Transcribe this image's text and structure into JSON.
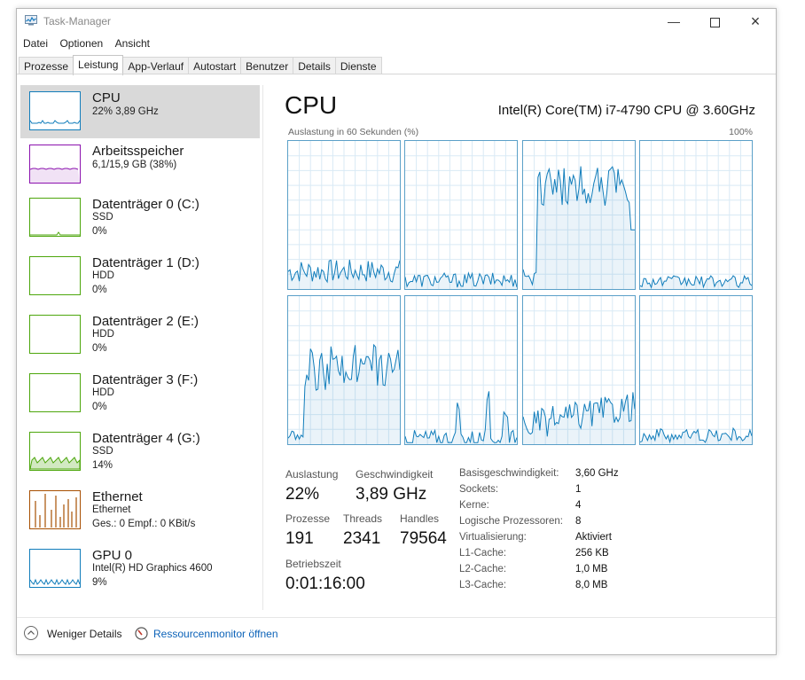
{
  "window": {
    "title": "Task-Manager",
    "icons": {
      "app": "task-manager-icon",
      "minimize": "minimize-icon",
      "maximize": "maximize-icon",
      "close": "close-icon"
    }
  },
  "menu": [
    "Datei",
    "Optionen",
    "Ansicht"
  ],
  "tabs": [
    {
      "label": "Prozesse",
      "active": false
    },
    {
      "label": "Leistung",
      "active": true
    },
    {
      "label": "App-Verlauf",
      "active": false
    },
    {
      "label": "Autostart",
      "active": false
    },
    {
      "label": "Benutzer",
      "active": false
    },
    {
      "label": "Details",
      "active": false
    },
    {
      "label": "Dienste",
      "active": false
    }
  ],
  "sidebar": [
    {
      "name": "CPU",
      "line1": "22% 3,89 GHz",
      "line2": "",
      "line3": "",
      "color": "#117dbb",
      "selected": true
    },
    {
      "name": "Arbeitsspeicher",
      "line1": "6,1/15,9 GB (38%)",
      "line2": "",
      "line3": "",
      "color": "#8b12ae",
      "selected": false
    },
    {
      "name": "Datenträger 0 (C:)",
      "line1": "SSD",
      "line2": "0%",
      "line3": "",
      "color": "#4da60c",
      "selected": false
    },
    {
      "name": "Datenträger 1 (D:)",
      "line1": "HDD",
      "line2": "0%",
      "line3": "",
      "color": "#4da60c",
      "selected": false
    },
    {
      "name": "Datenträger 2 (E:)",
      "line1": "HDD",
      "line2": "0%",
      "line3": "",
      "color": "#4da60c",
      "selected": false
    },
    {
      "name": "Datenträger 3 (F:)",
      "line1": "HDD",
      "line2": "0%",
      "line3": "",
      "color": "#4da60c",
      "selected": false
    },
    {
      "name": "Datenträger 4 (G:)",
      "line1": "SSD",
      "line2": "14%",
      "line3": "",
      "color": "#4da60c",
      "selected": false
    },
    {
      "name": "Ethernet",
      "line1": "Ethernet",
      "line2": "Ges.: 0 Empf.: 0 KBit/s",
      "line3": "",
      "color": "#a74f01",
      "selected": false
    },
    {
      "name": "GPU 0",
      "line1": "Intel(R) HD Graphics 4600",
      "line2": "9%",
      "line3": "",
      "color": "#117dbb",
      "selected": false
    }
  ],
  "main": {
    "title": "CPU",
    "model": "Intel(R) Core(TM) i7-4790 CPU @ 3.60GHz",
    "graph_label": "Auslastung in 60 Sekunden (%)",
    "graph_max": "100%",
    "accent_color": "#117dbb",
    "core_count_shown": 8
  },
  "stats": {
    "auslastung_label": "Auslastung",
    "auslastung": "22%",
    "geschwindigkeit_label": "Geschwindigkeit",
    "geschwindigkeit": "3,89 GHz",
    "prozesse_label": "Prozesse",
    "prozesse": "191",
    "threads_label": "Threads",
    "threads": "2341",
    "handles_label": "Handles",
    "handles": "79564",
    "betriebszeit_label": "Betriebszeit",
    "betriebszeit": "0:01:16:00"
  },
  "info": [
    {
      "label": "Basisgeschwindigkeit:",
      "value": "3,60 GHz"
    },
    {
      "label": "Sockets:",
      "value": "1"
    },
    {
      "label": "Kerne:",
      "value": "4"
    },
    {
      "label": "Logische Prozessoren:",
      "value": "8"
    },
    {
      "label": "Virtualisierung:",
      "value": "Aktiviert"
    },
    {
      "label": "L1-Cache:",
      "value": "256 KB"
    },
    {
      "label": "L2-Cache:",
      "value": "1,0 MB"
    },
    {
      "label": "L3-Cache:",
      "value": "8,0 MB"
    }
  ],
  "footer": {
    "fewer_details": "Weniger Details",
    "resource_monitor": "Ressourcenmonitor öffnen"
  }
}
